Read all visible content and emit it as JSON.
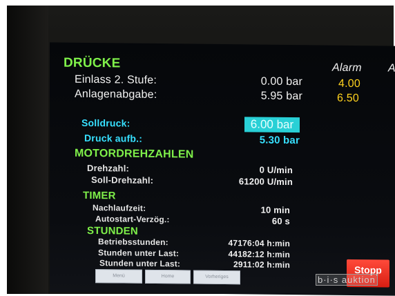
{
  "sections": {
    "druecke": "DRÜCKE",
    "motor": "MOTORDREHZAHLEN",
    "timer": "TIMER",
    "stunden": "STUNDEN"
  },
  "alarm_header": "Alarm",
  "alarm_header_cut": "A",
  "druecke": {
    "einlass": {
      "label": "Einlass 2. Stufe:",
      "value": "0.00 bar",
      "alarm": "4.00"
    },
    "anlage": {
      "label": "Anlagenabgabe:",
      "value": "5.95 bar",
      "alarm": "6.50"
    },
    "solldruck": {
      "label": "Solldruck:",
      "value": "6.00 bar"
    },
    "druck_aufb": {
      "label": "Druck aufb.:",
      "value": "5.30 bar"
    }
  },
  "motor": {
    "drehzahl": {
      "label": "Drehzahl:",
      "value": "0 U/min"
    },
    "soll": {
      "label": "Soll-Drehzahl:",
      "value": "61200 U/min"
    }
  },
  "timer": {
    "nachlauf": {
      "label": "Nachlaufzeit:",
      "value": "10 min"
    },
    "autostart": {
      "label": "Autostart-Verzög.:",
      "value": "60 s"
    }
  },
  "stunden": {
    "betrieb": {
      "label": "Betriebsstunden:",
      "value": "47176:04 h:min"
    },
    "unter_last1": {
      "label": "Stunden unter Last:",
      "value": "44182:12 h:min"
    },
    "unter_last2": {
      "label": "Stunden unter Last:",
      "value": "2911:02 h:min"
    }
  },
  "buttons": {
    "nav1": "Menü",
    "nav2": "Home",
    "nav3": "Vorheriges",
    "stop": "Stopp"
  },
  "watermark": "b·i·s auktion",
  "colors": {
    "header_green": "#7ff04a",
    "cyan": "#37e0ff",
    "alarm_yellow": "#ffd21e",
    "stop_red": "#e5281a"
  }
}
